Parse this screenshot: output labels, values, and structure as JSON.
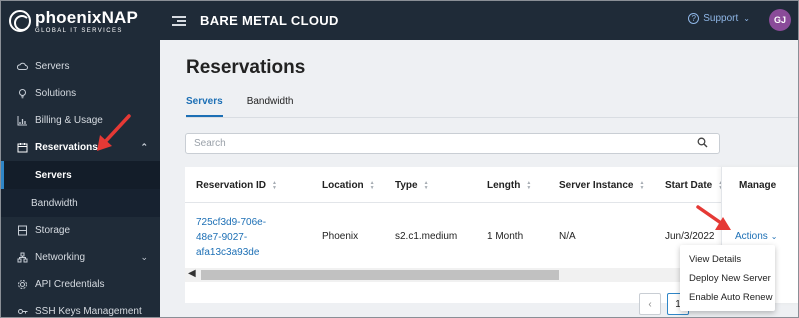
{
  "brand": {
    "name": "phoenixNAP",
    "tagline": "GLOBAL IT SERVICES"
  },
  "header": {
    "title": "BARE METAL CLOUD",
    "support_label": "Support",
    "avatar_initials": "GJ"
  },
  "sidebar": {
    "items": [
      {
        "label": "Servers",
        "icon": "cloud-icon"
      },
      {
        "label": "Solutions",
        "icon": "bulb-icon"
      },
      {
        "label": "Billing & Usage",
        "icon": "chart-icon"
      },
      {
        "label": "Reservations",
        "icon": "calendar-icon"
      },
      {
        "label": "Servers"
      },
      {
        "label": "Bandwidth"
      },
      {
        "label": "Storage",
        "icon": "storage-icon"
      },
      {
        "label": "Networking",
        "icon": "network-icon"
      },
      {
        "label": "API Credentials",
        "icon": "gear-icon"
      },
      {
        "label": "SSH Keys Management",
        "icon": "key-icon"
      }
    ]
  },
  "main": {
    "title": "Reservations",
    "tabs": [
      {
        "label": "Servers"
      },
      {
        "label": "Bandwidth"
      }
    ],
    "search": {
      "placeholder": "Search"
    },
    "table": {
      "columns": [
        "Reservation ID",
        "Location",
        "Type",
        "Length",
        "Server Instance",
        "Start Date",
        "Manage"
      ],
      "rows": [
        {
          "reservation_id": "725cf3d9-706e-48e7-9027-afa13c3a93de",
          "reservation_id_lines": [
            "725cf3d9-706e-",
            "48e7-9027-",
            "afa13c3a93de"
          ],
          "location": "Phoenix",
          "type": "s2.c1.medium",
          "length": "1 Month",
          "server_instance": "N/A",
          "start_date": "Jun/3/2022",
          "action_label": "Actions"
        }
      ]
    },
    "pagination": {
      "current_page": "1"
    },
    "actions_menu": [
      "View Details",
      "Deploy New Server",
      "Enable Auto Renew"
    ]
  },
  "colors": {
    "sidebar_bg": "#1f2b38",
    "accent": "#1c6fb5",
    "annotation": "#e53935",
    "avatar": "#8a4b99"
  }
}
